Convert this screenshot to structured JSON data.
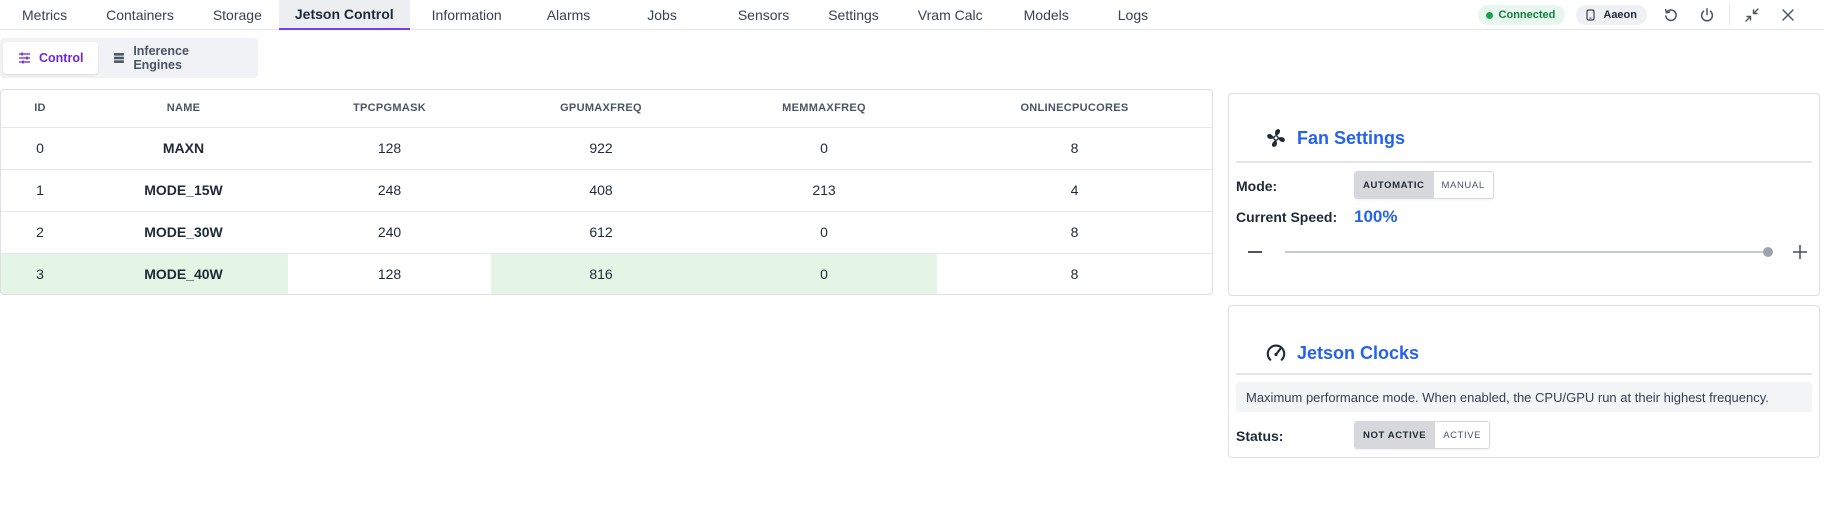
{
  "nav": {
    "tabs": [
      "Metrics",
      "Containers",
      "Storage",
      "Jetson Control",
      "Information",
      "Alarms",
      "Jobs",
      "Sensors",
      "Settings",
      "Vram Calc",
      "Models",
      "Logs"
    ],
    "active_tab": "Jetson Control",
    "status": "Connected",
    "device": "Aaeon"
  },
  "subtabs": {
    "control": "Control",
    "engines": "Inference Engines"
  },
  "table": {
    "columns": [
      "ID",
      "NAME",
      "TPCPGMASK",
      "GPUMAXFREQ",
      "MEMMAXFREQ",
      "ONLINECPUCORES"
    ],
    "rows": [
      [
        "0",
        "MAXN",
        "128",
        "922",
        "0",
        "8"
      ],
      [
        "1",
        "MODE_15W",
        "248",
        "408",
        "213",
        "4"
      ],
      [
        "2",
        "MODE_30W",
        "240",
        "612",
        "0",
        "8"
      ],
      [
        "3",
        "MODE_40W",
        "128",
        "816",
        "0",
        "8"
      ]
    ],
    "selected_row": 3
  },
  "fan": {
    "title": "Fan Settings",
    "mode_label": "Mode:",
    "mode_options": [
      "AUTOMATIC",
      "MANUAL"
    ],
    "mode_selected": "AUTOMATIC",
    "speed_label": "Current Speed:",
    "speed_value": "100%",
    "speed_fraction": 1.0
  },
  "clocks": {
    "title": "Jetson Clocks",
    "description": "Maximum performance mode. When enabled, the CPU/GPU run at their highest frequency.",
    "status_label": "Status:",
    "status_options": [
      "NOT ACTIVE",
      "ACTIVE"
    ],
    "status_selected": "NOT ACTIVE"
  },
  "colors": {
    "accent": "#7c3aed",
    "title_blue": "#2563eb",
    "connected_green": "#16a34a",
    "row_highlight": "#e4f5e6"
  }
}
